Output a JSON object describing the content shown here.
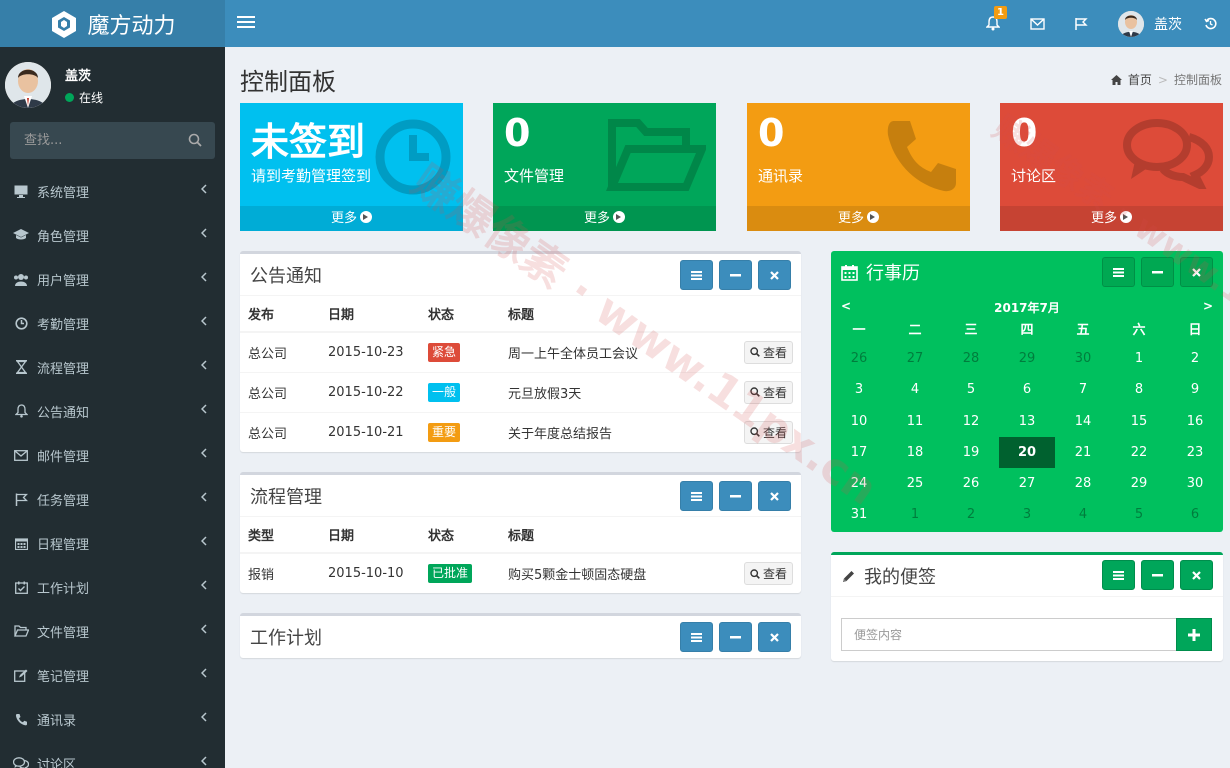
{
  "app": {
    "logo_text": "魔方动力"
  },
  "topbar": {
    "notification_count": "1",
    "username": "盖茨"
  },
  "sidebar": {
    "user_name": "盖茨",
    "user_status": "在线",
    "search_placeholder": "查找...",
    "items": [
      {
        "label": "系统管理",
        "icon": "desktop-icon"
      },
      {
        "label": "角色管理",
        "icon": "graduation-cap-icon"
      },
      {
        "label": "用户管理",
        "icon": "users-icon"
      },
      {
        "label": "考勤管理",
        "icon": "clock-icon"
      },
      {
        "label": "流程管理",
        "icon": "hourglass-icon"
      },
      {
        "label": "公告通知",
        "icon": "bell-icon"
      },
      {
        "label": "邮件管理",
        "icon": "envelope-icon"
      },
      {
        "label": "任务管理",
        "icon": "flag-icon"
      },
      {
        "label": "日程管理",
        "icon": "calendar-icon"
      },
      {
        "label": "工作计划",
        "icon": "calendar-check-icon"
      },
      {
        "label": "文件管理",
        "icon": "folder-open-icon"
      },
      {
        "label": "笔记管理",
        "icon": "edit-icon"
      },
      {
        "label": "通讯录",
        "icon": "phone-icon"
      },
      {
        "label": "讨论区",
        "icon": "comments-icon"
      }
    ]
  },
  "page": {
    "title": "控制面板",
    "breadcrumb_home": "首页",
    "breadcrumb_current": "控制面板"
  },
  "info_boxes": [
    {
      "value": "未签到",
      "label": "请到考勤管理签到",
      "more": "更多",
      "color": "#00c0ef",
      "icon": "clock-icon"
    },
    {
      "value": "0",
      "label": "文件管理",
      "more": "更多",
      "color": "#00a65a",
      "icon": "folder-open-icon"
    },
    {
      "value": "0",
      "label": "通讯录",
      "more": "更多",
      "color": "#f39c12",
      "icon": "phone-icon"
    },
    {
      "value": "0",
      "label": "讨论区",
      "more": "更多",
      "color": "#dd4b39",
      "icon": "comments-icon"
    }
  ],
  "notice": {
    "title": "公告通知",
    "headers": [
      "发布",
      "日期",
      "状态",
      "标题"
    ],
    "rows": [
      {
        "publisher": "总公司",
        "date": "2015-10-23",
        "status": "紧急",
        "status_color": "#dd4b39",
        "title": "周一上午全体员工会议",
        "action": "查看"
      },
      {
        "publisher": "总公司",
        "date": "2015-10-22",
        "status": "一般",
        "status_color": "#00c0ef",
        "title": "元旦放假3天",
        "action": "查看"
      },
      {
        "publisher": "总公司",
        "date": "2015-10-21",
        "status": "重要",
        "status_color": "#f39c12",
        "title": "关于年度总结报告",
        "action": "查看"
      }
    ]
  },
  "process": {
    "title": "流程管理",
    "headers": [
      "类型",
      "日期",
      "状态",
      "标题"
    ],
    "rows": [
      {
        "type": "报销",
        "date": "2015-10-10",
        "status": "已批准",
        "status_color": "#00a65a",
        "title": "购买5颗金士顿固态硬盘",
        "action": "查看"
      }
    ]
  },
  "workplan": {
    "title": "工作计划"
  },
  "calendar": {
    "title": "行事历",
    "month": "2017年7月",
    "prev": "<",
    "next": ">",
    "weekdays": [
      "一",
      "二",
      "三",
      "四",
      "五",
      "六",
      "日"
    ],
    "weeks": [
      [
        {
          "d": "26",
          "m": 1
        },
        {
          "d": "27",
          "m": 1
        },
        {
          "d": "28",
          "m": 1
        },
        {
          "d": "29",
          "m": 1
        },
        {
          "d": "30",
          "m": 1
        },
        {
          "d": "1"
        },
        {
          "d": "2"
        }
      ],
      [
        {
          "d": "3"
        },
        {
          "d": "4"
        },
        {
          "d": "5"
        },
        {
          "d": "6"
        },
        {
          "d": "7"
        },
        {
          "d": "8"
        },
        {
          "d": "9"
        }
      ],
      [
        {
          "d": "10"
        },
        {
          "d": "11"
        },
        {
          "d": "12"
        },
        {
          "d": "13"
        },
        {
          "d": "14"
        },
        {
          "d": "15"
        },
        {
          "d": "16"
        }
      ],
      [
        {
          "d": "17"
        },
        {
          "d": "18"
        },
        {
          "d": "19"
        },
        {
          "d": "20",
          "t": 1
        },
        {
          "d": "21"
        },
        {
          "d": "22"
        },
        {
          "d": "23"
        }
      ],
      [
        {
          "d": "24"
        },
        {
          "d": "25"
        },
        {
          "d": "26"
        },
        {
          "d": "27"
        },
        {
          "d": "28"
        },
        {
          "d": "29"
        },
        {
          "d": "30"
        }
      ],
      [
        {
          "d": "31"
        },
        {
          "d": "1",
          "m": 1
        },
        {
          "d": "2",
          "m": 1
        },
        {
          "d": "3",
          "m": 1
        },
        {
          "d": "4",
          "m": 1
        },
        {
          "d": "5",
          "m": 1
        },
        {
          "d": "6",
          "m": 1
        }
      ]
    ]
  },
  "notes": {
    "title": "我的便签",
    "placeholder": "便签内容"
  },
  "watermark": {
    "text": "赚爆像素 · www.11px.cn"
  }
}
